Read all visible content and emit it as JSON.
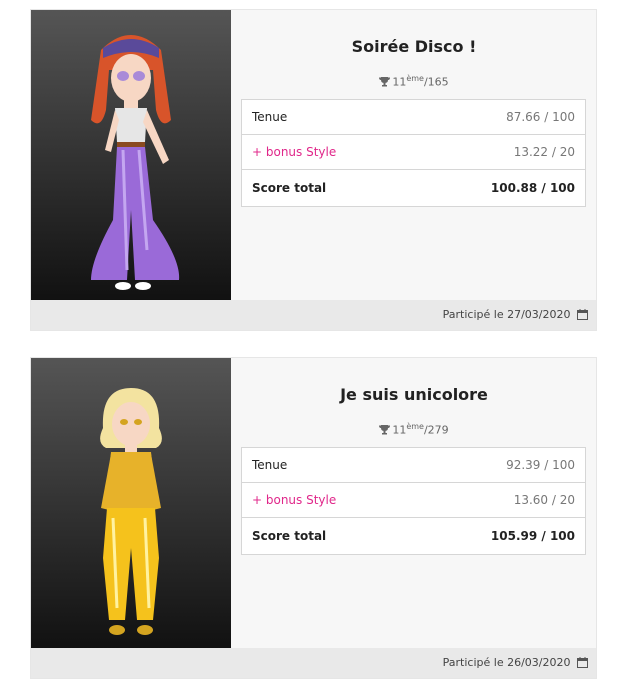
{
  "cards": [
    {
      "title": "Soirée Disco !",
      "rank_pos": "11",
      "rank_sup": "ème",
      "rank_total": "/165",
      "rows": [
        {
          "label": "Tenue",
          "value": "87.66 / 100"
        },
        {
          "label": "+ bonus Style",
          "value": "13.22 / 20"
        },
        {
          "label": "Score total",
          "value": "100.88 / 100"
        }
      ],
      "date": "Participé le 27/03/2020"
    },
    {
      "title": "Je suis unicolore",
      "rank_pos": "11",
      "rank_sup": "ème",
      "rank_total": "/279",
      "rows": [
        {
          "label": "Tenue",
          "value": "92.39 / 100"
        },
        {
          "label": "+ bonus Style",
          "value": "13.60 / 20"
        },
        {
          "label": "Score total",
          "value": "105.99 / 100"
        }
      ],
      "date": "Participé le 26/03/2020"
    }
  ],
  "colors": {
    "bonus": "#e0278a",
    "footer_bg": "#e9e9e9",
    "card_bg": "#f7f7f7"
  },
  "icons": {
    "rank": "trophy-icon",
    "date": "calendar-icon"
  }
}
